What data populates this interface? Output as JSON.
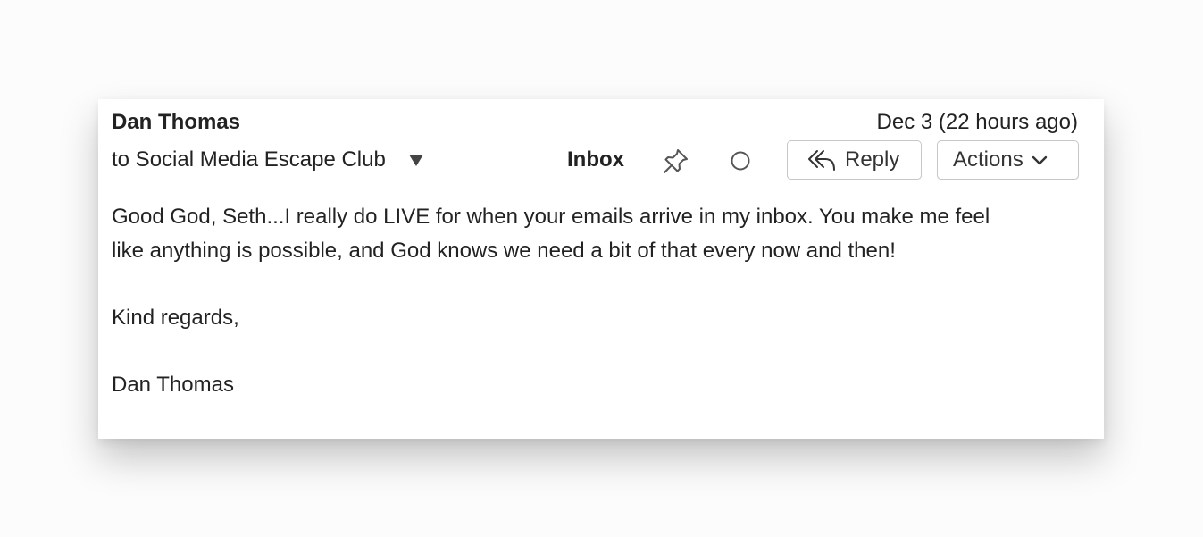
{
  "email": {
    "sender": "Dan Thomas",
    "date": "Dec 3 (22 hours ago)",
    "recipients": "to Social Media Escape Club",
    "folder": "Inbox",
    "reply_label": "Reply",
    "actions_label": "Actions",
    "body": {
      "paragraph1": "Good God, Seth...I really do LIVE for when your emails arrive in my inbox. You make me feel like anything is possible, and God knows we need a bit of that every now and then!",
      "closing": "Kind regards,",
      "signature": "Dan Thomas"
    }
  },
  "icons": {
    "recipients_toggle": "caret-down-icon",
    "pin": "pin-icon",
    "status": "circle-icon",
    "reply": "reply-arrow-icon",
    "actions": "chevron-down-icon"
  }
}
